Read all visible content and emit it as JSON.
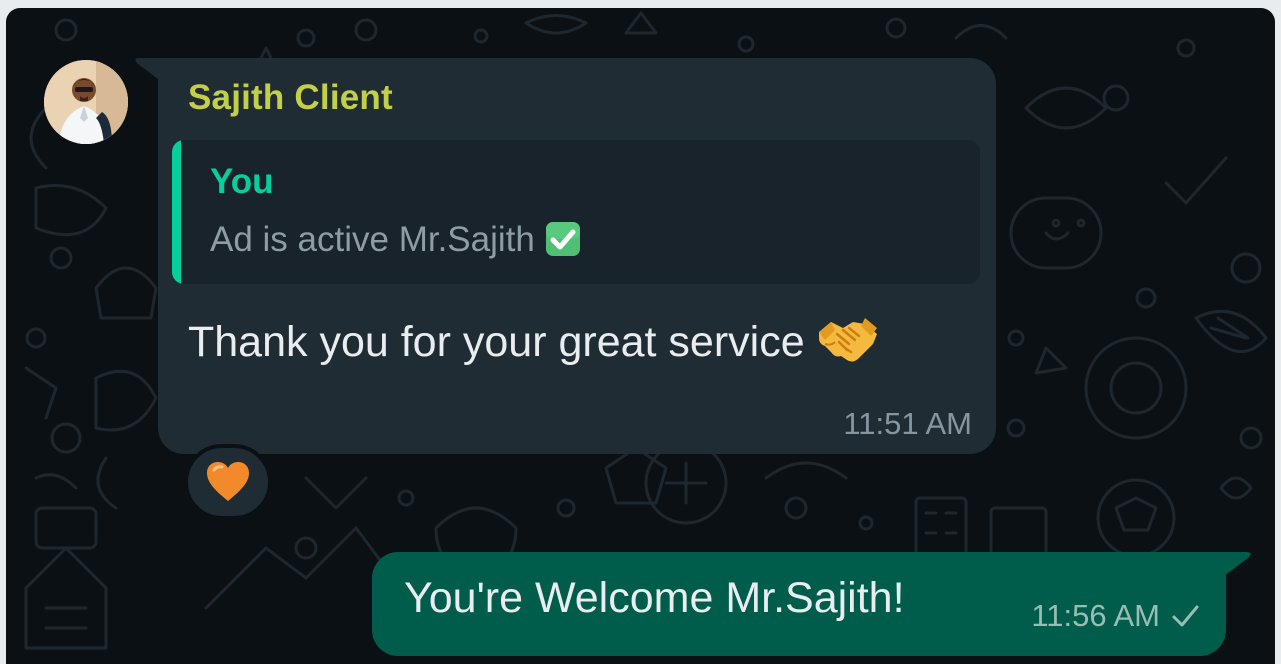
{
  "chat": {
    "incoming": {
      "sender_name": "Sajith Client",
      "quoted": {
        "author": "You",
        "text": "Ad is active Mr.Sajith",
        "emoji": "check-mark-button-emoji"
      },
      "text": "Thank you for your great service",
      "emoji": "handshake-emoji",
      "time": "11:51 AM",
      "reaction": "orange-heart-emoji"
    },
    "outgoing": {
      "text": "You're Welcome Mr.Sajith!",
      "time": "11:56 AM",
      "status": "sent-single-tick"
    }
  },
  "colors": {
    "background": "#0b1014",
    "incoming_bubble": "#1f2c34",
    "outgoing_bubble": "#005c4b",
    "sender_name": "#c4cf48",
    "quote_accent": "#06cf9c"
  }
}
